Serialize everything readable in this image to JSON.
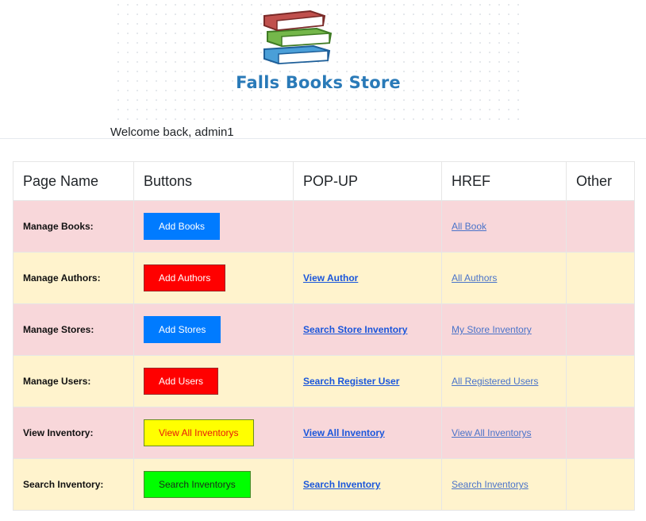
{
  "header": {
    "logo_text": "Falls Books Store",
    "welcome": "Welcome back, admin1"
  },
  "table": {
    "columns": [
      "Page Name",
      "Buttons",
      "POP-UP",
      "HREF",
      "Other"
    ],
    "rows": [
      {
        "page": "Manage Books:",
        "button": "Add Books",
        "popup": "",
        "href": "All Book",
        "other": ""
      },
      {
        "page": "Manage Authors:",
        "button": "Add Authors",
        "popup": "View Author",
        "href": "All Authors",
        "other": ""
      },
      {
        "page": "Manage Stores:",
        "button": "Add Stores",
        "popup": "Search Store Inventory",
        "href": "My Store Inventory",
        "other": ""
      },
      {
        "page": "Manage Users:",
        "button": "Add Users",
        "popup": "Search Register User",
        "href": "All Registered Users",
        "other": ""
      },
      {
        "page": "View Inventory:",
        "button": "View All Inventorys",
        "popup": "View All Inventory",
        "href": "View All Inventorys",
        "other": ""
      },
      {
        "page": "Search Inventory:",
        "button": "Search Inventorys",
        "popup": "Search Inventory",
        "href": "Search Inventorys",
        "other": ""
      }
    ]
  },
  "colors": {
    "row_pink": "#f8d7da",
    "row_yellow": "#fff3cd",
    "btn_blue": "#007bff",
    "btn_red": "#ff0000",
    "btn_yellow": "#ffff00",
    "btn_green": "#00ff00",
    "logo_blue": "#2a7ab8"
  }
}
